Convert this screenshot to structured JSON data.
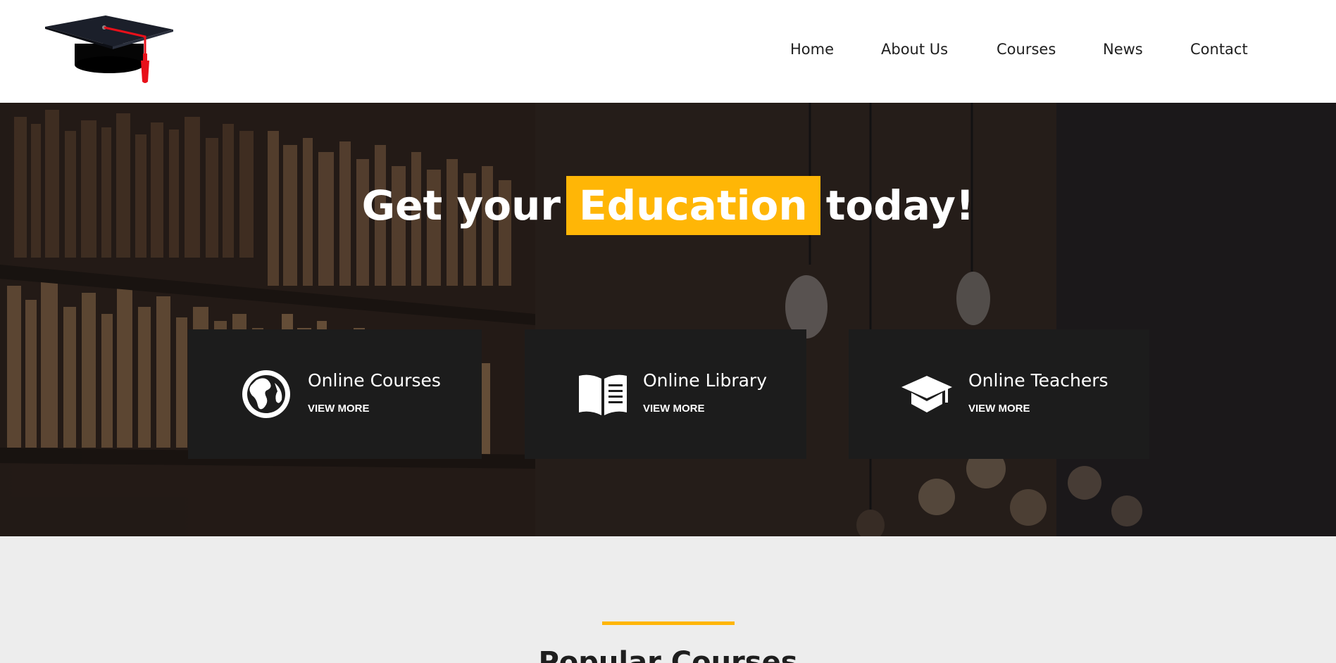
{
  "nav": {
    "items": [
      {
        "label": "Home"
      },
      {
        "label": "About Us"
      },
      {
        "label": "Courses"
      },
      {
        "label": "News"
      },
      {
        "label": "Contact"
      }
    ]
  },
  "hero": {
    "headline_before": "Get your",
    "headline_highlight": "Education",
    "headline_after": "today!",
    "cards": [
      {
        "title": "Online Courses",
        "link": "VIEW MORE",
        "icon": "globe-icon"
      },
      {
        "title": "Online Library",
        "link": "VIEW MORE",
        "icon": "open-book-icon"
      },
      {
        "title": "Online Teachers",
        "link": "VIEW MORE",
        "icon": "graduation-cap-icon"
      }
    ]
  },
  "section": {
    "title": "Popular Courses"
  },
  "colors": {
    "accent": "#ffb606",
    "card_bg": "#1c1c1c",
    "section_bg": "#ededed"
  }
}
